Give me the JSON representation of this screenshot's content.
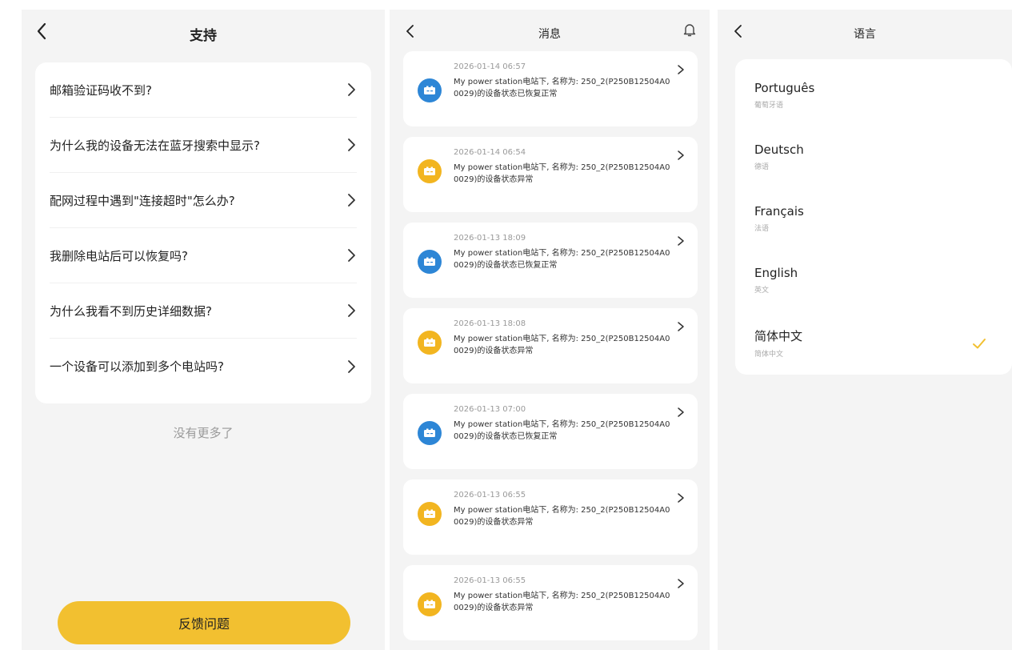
{
  "support": {
    "title": "支持",
    "faqs": [
      "邮箱验证码收不到?",
      "为什么我的设备无法在蓝牙搜索中显示?",
      "配网过程中遇到\"连接超时\"怎么办?",
      "我删除电站后可以恢复吗?",
      "为什么我看不到历史详细数据?",
      "一个设备可以添加到多个电站吗?"
    ],
    "no_more": "没有更多了",
    "feedback_label": "反馈问题"
  },
  "messages": {
    "title": "消息",
    "items": [
      {
        "time": "2026-01-14 06:57",
        "text": "My power station电站下, 名称为: 250_2(P250B12504A00029)的设备状态已恢复正常",
        "status": "recovered",
        "color": "#2d86d6"
      },
      {
        "time": "2026-01-14 06:54",
        "text": "My power station电站下, 名称为: 250_2(P250B12504A00029)的设备状态异常",
        "status": "abnormal",
        "color": "#f2b520"
      },
      {
        "time": "2026-01-13 18:09",
        "text": "My power station电站下, 名称为: 250_2(P250B12504A00029)的设备状态已恢复正常",
        "status": "recovered",
        "color": "#2d86d6"
      },
      {
        "time": "2026-01-13 18:08",
        "text": "My power station电站下, 名称为: 250_2(P250B12504A00029)的设备状态异常",
        "status": "abnormal",
        "color": "#f2b520"
      },
      {
        "time": "2026-01-13 07:00",
        "text": "My power station电站下, 名称为: 250_2(P250B12504A00029)的设备状态已恢复正常",
        "status": "recovered",
        "color": "#2d86d6"
      },
      {
        "time": "2026-01-13 06:55",
        "text": "My power station电站下, 名称为: 250_2(P250B12504A00029)的设备状态异常",
        "status": "abnormal",
        "color": "#f2b520"
      },
      {
        "time": "2026-01-13 06:55",
        "text": "My power station电站下, 名称为: 250_2(P250B12504A00029)的设备状态异常",
        "status": "abnormal",
        "color": "#f2b520"
      }
    ]
  },
  "language": {
    "title": "语言",
    "options": [
      {
        "name": "Português",
        "native": "葡萄牙语",
        "selected": false
      },
      {
        "name": "Deutsch",
        "native": "德语",
        "selected": false
      },
      {
        "name": "Français",
        "native": "法语",
        "selected": false
      },
      {
        "name": "English",
        "native": "英文",
        "selected": false
      },
      {
        "name": "简体中文",
        "native": "简体中文",
        "selected": true
      }
    ]
  },
  "colors": {
    "accent": "#f2c030",
    "blue_icon": "#2d86d6",
    "yellow_icon": "#f2b520",
    "check": "#f2c030"
  },
  "icons": [
    "back-arrow-icon",
    "chevron-right-icon",
    "bell-icon",
    "battery-icon",
    "checkmark-icon"
  ]
}
